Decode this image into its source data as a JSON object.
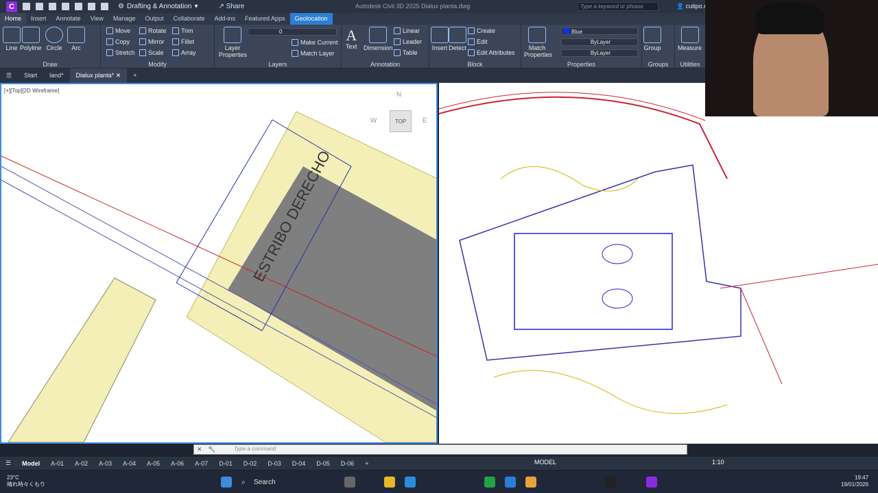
{
  "titlebar": {
    "app_logo": "C",
    "workspace": "Drafting & Annotation",
    "share": "Share",
    "doc_title": "Autodesk Civil 3D 2025   Dialux planta.dwg",
    "search_placeholder": "Type a keyword or phrase",
    "user": "cutipo.e"
  },
  "ribbon_tabs": [
    "Home",
    "Insert",
    "Annotate",
    "View",
    "Manage",
    "Output",
    "Collaborate",
    "Add-ins",
    "Featured Apps",
    "Geolocation"
  ],
  "ribbon": {
    "draw": {
      "title": "Draw",
      "buttons": [
        "Line",
        "Polyline",
        "Circle",
        "Arc"
      ]
    },
    "modify": {
      "title": "Modify",
      "rows": [
        [
          "Move",
          "Rotate",
          "Trim"
        ],
        [
          "Copy",
          "Mirror",
          "Fillet"
        ],
        [
          "Stretch",
          "Scale",
          "Array"
        ]
      ]
    },
    "layers": {
      "title": "Layers",
      "layer_properties": "Layer Properties",
      "current_layer": "0",
      "make_current": "Make Current",
      "match_layer": "Match Layer"
    },
    "annotation": {
      "title": "Annotation",
      "text": "Text",
      "dimension": "Dimension",
      "linear": "Linear",
      "leader": "Leader",
      "table": "Table"
    },
    "block": {
      "title": "Block",
      "insert": "Insert",
      "detect": "Detect",
      "create": "Create",
      "edit": "Edit",
      "edit_attributes": "Edit Attributes"
    },
    "properties": {
      "title": "Properties",
      "match_properties": "Match Properties",
      "color": "Blue",
      "linetype": "ByLayer",
      "lineweight": "ByLayer"
    },
    "groups": {
      "title": "Groups",
      "group": "Group"
    },
    "utilities": {
      "title": "Utilities",
      "measure": "Measure"
    }
  },
  "file_tabs": [
    "Start",
    "land*",
    "Dialux planta*"
  ],
  "viewport_left": {
    "label": "[+][Top][2D Wireframe]",
    "viewcube": {
      "n": "N",
      "w": "W",
      "e": "E",
      "top": "TOP"
    },
    "annotation_text": "ESTRIBO DERECHO"
  },
  "command": {
    "placeholder": "Type a command"
  },
  "layout_tabs": [
    "Model",
    "A-01",
    "A-02",
    "A-03",
    "A-04",
    "A-05",
    "A-06",
    "A-07",
    "D-01",
    "D-02",
    "D-03",
    "D-04",
    "D-05",
    "D-06"
  ],
  "status": {
    "mode": "MODEL",
    "scale": "1:10"
  },
  "taskbar": {
    "temperature": "23°C",
    "weather": "晴れ時々くもり",
    "search": "Search",
    "time": "19:47",
    "date": "19/01/2026"
  }
}
